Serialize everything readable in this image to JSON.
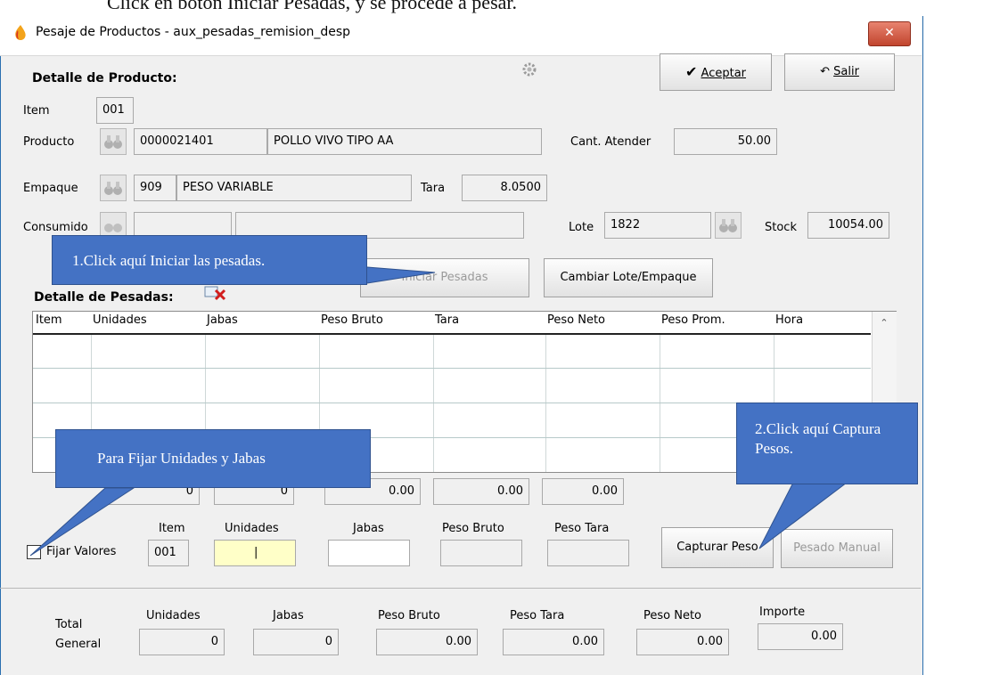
{
  "doc_text": "Click en botón Iniciar Pesadas, y se procede a pesar.",
  "window": {
    "title": "Pesaje de Productos - aux_pesadas_remision_desp",
    "close_glyph": "✕"
  },
  "header": {
    "section_title": "Detalle de Producto:",
    "accept_label": "Aceptar",
    "exit_label": "Salir"
  },
  "fields": {
    "item_label": "Item",
    "item_value": "001",
    "producto_label": "Producto",
    "producto_code": "0000021401",
    "producto_name": "POLLO VIVO TIPO AA",
    "cant_label": "Cant. Atender",
    "cant_value": "50.00",
    "empaque_label": "Empaque",
    "empaque_code": "909",
    "empaque_name": "PESO VARIABLE",
    "tara_label": "Tara",
    "tara_value": "8.0500",
    "consumido_label": "Consumido",
    "lote_label": "Lote",
    "lote_value": "1822",
    "stock_label": "Stock",
    "stock_value": "10054.00"
  },
  "actions": {
    "iniciar_label": "Iniciar Pesadas",
    "cambiar_label": "Cambiar Lote/Empaque"
  },
  "pesadas": {
    "section_title": "Detalle de Pesadas:",
    "columns": [
      "Item",
      "Unidades",
      "Jabas",
      "Peso Bruto",
      "Tara",
      "Peso Neto",
      "Peso Prom.",
      "Hora"
    ],
    "totals": [
      "0",
      "0",
      "0.00",
      "0.00",
      "0.00"
    ]
  },
  "entry": {
    "fijar_label": "Fijar Valores",
    "item_label": "Item",
    "item_value": "001",
    "unidades_label": "Unidades",
    "unidades_value": "|",
    "jabas_label": "Jabas",
    "jabas_value": "",
    "peso_bruto_label": "Peso Bruto",
    "peso_bruto_value": "",
    "peso_tara_label": "Peso Tara",
    "peso_tara_value": "",
    "capturar_label": "Capturar Peso",
    "manual_label": "Pesado Manual"
  },
  "total_general": {
    "label_line1": "Total",
    "label_line2": "General",
    "unidades_label": "Unidades",
    "unidades_value": "0",
    "jabas_label": "Jabas",
    "jabas_value": "0",
    "peso_bruto_label": "Peso Bruto",
    "peso_bruto_value": "0.00",
    "peso_tara_label": "Peso Tara",
    "peso_tara_value": "0.00",
    "peso_neto_label": "Peso Neto",
    "peso_neto_value": "0.00",
    "importe_label": "Importe",
    "importe_value": "0.00"
  },
  "callouts": {
    "one": "1.Click aquí Iniciar las pesadas.",
    "two": "2.Click aquí Captura Pesos.",
    "fijar": "Para Fijar Unidades y Jabas"
  },
  "colors": {
    "callout": "#4472c4",
    "highlight_input": "#ffffc8",
    "close": "#c1452e"
  }
}
